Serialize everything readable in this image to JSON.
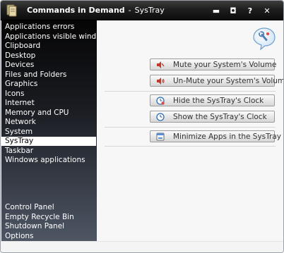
{
  "window": {
    "title": "Commands in Demand",
    "separator": "-",
    "subtitle": "SysTray",
    "buttons": {
      "minimize": "▬",
      "restore": "◘",
      "help": "?",
      "close": "✕"
    }
  },
  "sidebar": {
    "items": [
      "Applications errors",
      "Applications visible windows",
      "Clipboard",
      "Desktop",
      "Devices",
      "Files and Folders",
      "Graphics",
      "Icons",
      "Internet",
      "Memory and CPU",
      "Network",
      "System",
      "SysTray",
      "Taskbar",
      "Windows applications"
    ],
    "selected": "SysTray",
    "bottom_items": [
      "Control Panel",
      "Empty Recycle Bin",
      "Shutdown Panel",
      "Options"
    ]
  },
  "main": {
    "header_icon": "systray-wrench-speech-bubble-icon",
    "actions": [
      {
        "label": "Mute your System's Volume",
        "icon": "speaker-mute-icon"
      },
      {
        "label": "Un-Mute your System's Volume",
        "icon": "speaker-unmute-icon"
      },
      {
        "label": "Hide the SysTray's Clock",
        "icon": "clock-hide-icon"
      },
      {
        "label": "Show the SysTray's Clock",
        "icon": "clock-show-icon"
      },
      {
        "label": "Minimize Apps in the SysTray",
        "icon": "minimize-apps-icon"
      }
    ]
  },
  "colors": {
    "titlebar": "#1e1e1e",
    "sidebar_top": "#050505",
    "sidebar_bottom": "#4e5664",
    "selected_bg": "#ffffff",
    "panel_bg": "#f7f7f7"
  }
}
